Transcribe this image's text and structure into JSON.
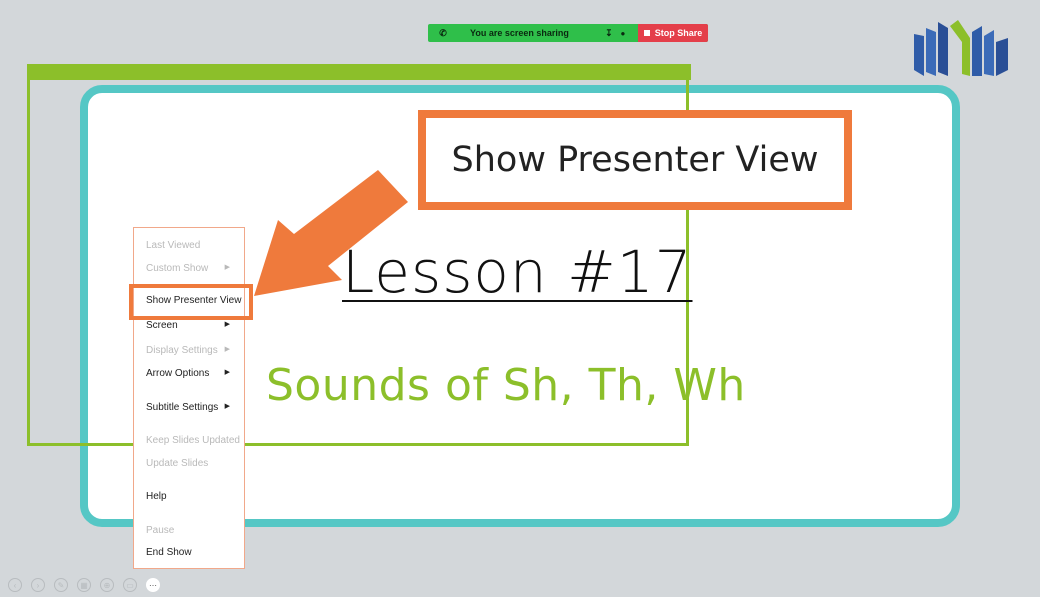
{
  "share_bar": {
    "message": "You are screen sharing",
    "stop_label": "Stop Share",
    "phone_icon": "phone-icon",
    "color": "#2fbf4a",
    "stop_color": "#e43f4a"
  },
  "slide": {
    "title": "Lesson #17",
    "subtitle": "Sounds of Sh, Th, Wh",
    "border_color": "#55c7c5",
    "accent_green": "#8cbf2a"
  },
  "callout": {
    "text": "Show Presenter View",
    "color": "#ef7a3c"
  },
  "menu": {
    "items": [
      {
        "label": "Last Viewed",
        "disabled": true,
        "submenu": false
      },
      {
        "label": "Custom Show",
        "disabled": true,
        "submenu": true
      },
      {
        "label": "Show Presenter View",
        "disabled": false,
        "submenu": false
      },
      {
        "label": "Screen",
        "disabled": false,
        "submenu": true
      },
      {
        "label": "Display Settings",
        "disabled": true,
        "submenu": true
      },
      {
        "label": "Arrow Options",
        "disabled": false,
        "submenu": true
      },
      {
        "label": "Subtitle Settings",
        "disabled": false,
        "submenu": true
      },
      {
        "label": "Keep Slides Updated",
        "disabled": true,
        "submenu": false
      },
      {
        "label": "Update Slides",
        "disabled": true,
        "submenu": false
      },
      {
        "label": "Help",
        "disabled": false,
        "submenu": false
      },
      {
        "label": "Pause",
        "disabled": true,
        "submenu": false
      },
      {
        "label": "End Show",
        "disabled": false,
        "submenu": false
      }
    ]
  },
  "toolbar": {
    "icons": [
      "previous-icon",
      "next-icon",
      "pen-icon",
      "grid-icon",
      "zoom-icon",
      "subtitles-icon",
      "more-options-icon"
    ]
  }
}
